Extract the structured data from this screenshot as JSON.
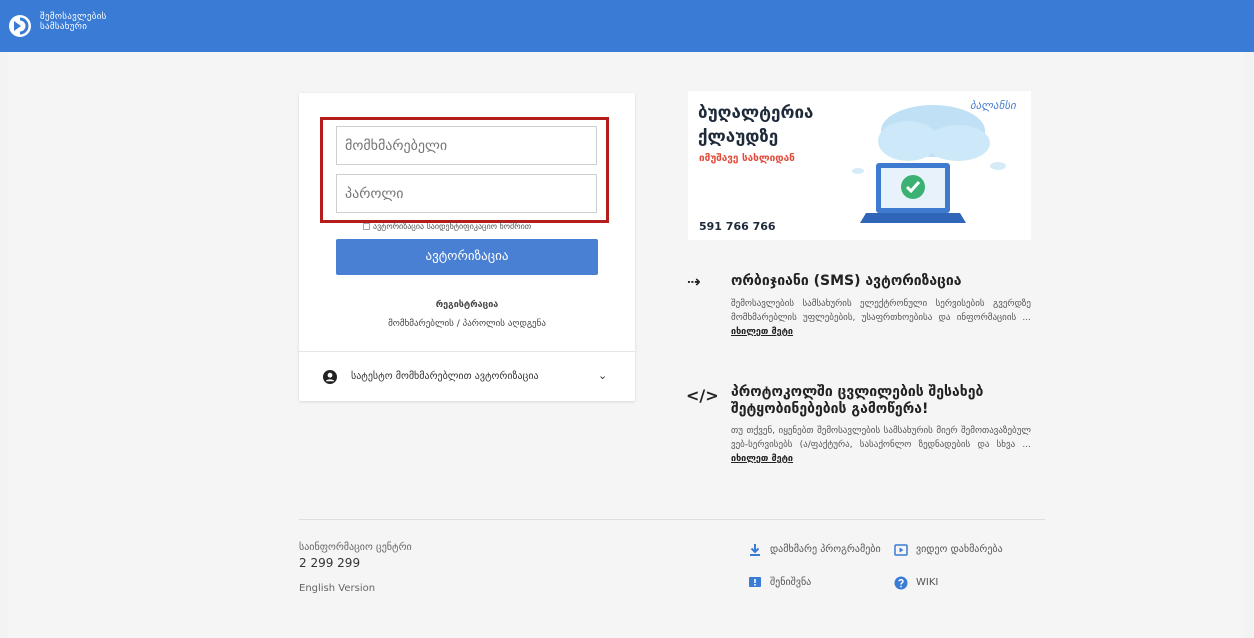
{
  "header": {
    "logo_line1": "შემოსავლების",
    "logo_line2": "სამსახური",
    "brand_color": "#3a7bd5"
  },
  "login": {
    "username_placeholder": "მომხმარებელი",
    "password_placeholder": "პაროლი",
    "cert_option": "ავტორიზაცია საიდენტიფიკაციო ნომრით",
    "submit_label": "ავტორიზაცია",
    "register_link": "რეგისტრაცია",
    "recover_link": "მომხმარებლის / პაროლის აღდგენა",
    "test_user_label": "სატესტო მომხმარებლით ავტორიზაცია",
    "accent_color": "#4a80d3",
    "highlight_color": "#b51c1c"
  },
  "banner": {
    "title_line1": "ბუღალტერია",
    "title_line2": "ქლაუდზე",
    "subtitle": "იმუშავე სახლიდან",
    "phone": "591 766 766",
    "brand": "ბალანსი"
  },
  "sections": [
    {
      "icon": "login-arrow-icon",
      "title": "ორბიჯიანი (SMS) ავტორიზაცია",
      "text": "შემოსავლების სამსახურის ელექტრონული სერვისების გვერდზე მომხმარებლის უფლებების, უსაფრთხოებისა და ინფორმაციის ... ",
      "more": "იხილეთ მეტი"
    },
    {
      "icon": "code-icon",
      "title": "პროტოკოლში ცვლილების შესახებ შეტყობინებების გამოწერა!",
      "text": "თუ თქვენ, იყენებთ შემოსავლების სამსახურის მიერ შემოთავაზებულ ვებ-სერვისებს (ა/ფაქტურა, სასაქონლო ზედნადების და სხვა ... ",
      "more": "იხილეთ მეტი"
    }
  ],
  "footer": {
    "info_center_label": "საინფორმაციო ცენტრი",
    "info_center_phone": "2 299 299",
    "english_version": "English Version",
    "links": {
      "download": "დამხმარე პროგრამები",
      "video": "ვიდეო დახმარება",
      "feedback": "შენიშვნა",
      "wiki": "WIKI"
    }
  }
}
